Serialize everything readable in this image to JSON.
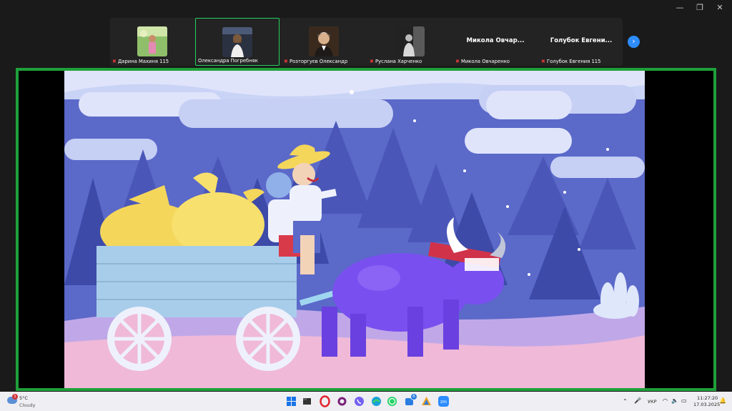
{
  "participants": [
    {
      "name": "Дарина Махиня 115",
      "has_video": true
    },
    {
      "name": "Олександра Погребняк",
      "has_video": true
    },
    {
      "name": "Розторгуєв Олександр",
      "has_video": true
    },
    {
      "name": "Руслана Харченко",
      "has_video": true
    },
    {
      "name": "Микола Овчаренко",
      "display_name": "Микола Овчар...",
      "has_video": false
    },
    {
      "name": "Голубок Евгения 115",
      "display_name": "Голубок Евгени...",
      "has_video": false
    }
  ],
  "active_participant_index": 1,
  "colors": {
    "active_border": "#23d160",
    "share_border": "#1fa03a",
    "next_button": "#2d8cff",
    "muted_mic": "#e5383b"
  },
  "taskbar": {
    "weather_temp": "5°C",
    "weather_desc": "Cloudy",
    "weather_badge": "1",
    "language": "УКР",
    "time": "11:27:20",
    "date": "17.03.2025",
    "store_badge": "6"
  }
}
